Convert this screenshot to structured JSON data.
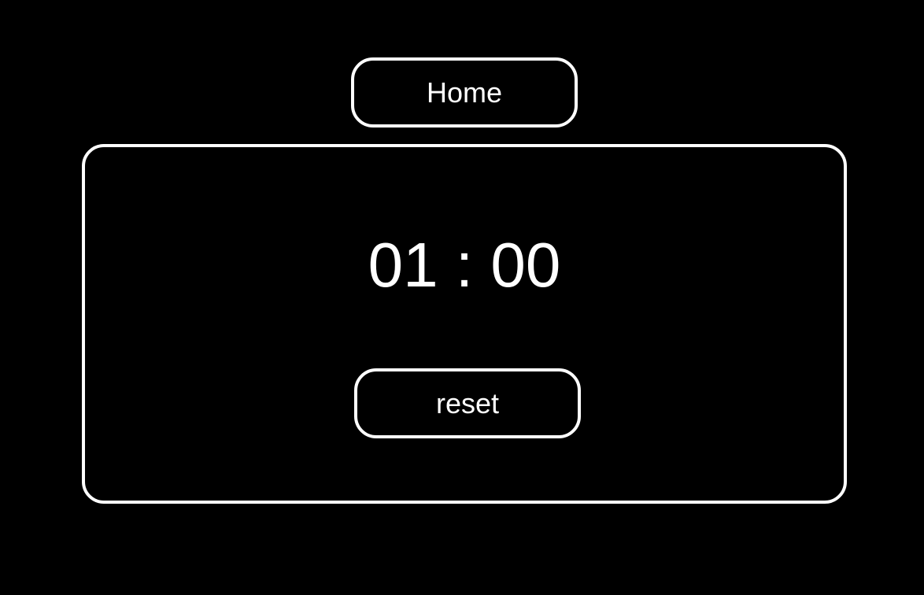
{
  "nav": {
    "home_label": "Home"
  },
  "timer": {
    "minutes": "01",
    "separator": ":",
    "seconds": "00",
    "display": "01 : 00",
    "reset_label": "reset"
  },
  "colors": {
    "background": "#000000",
    "foreground": "#ffffff"
  }
}
